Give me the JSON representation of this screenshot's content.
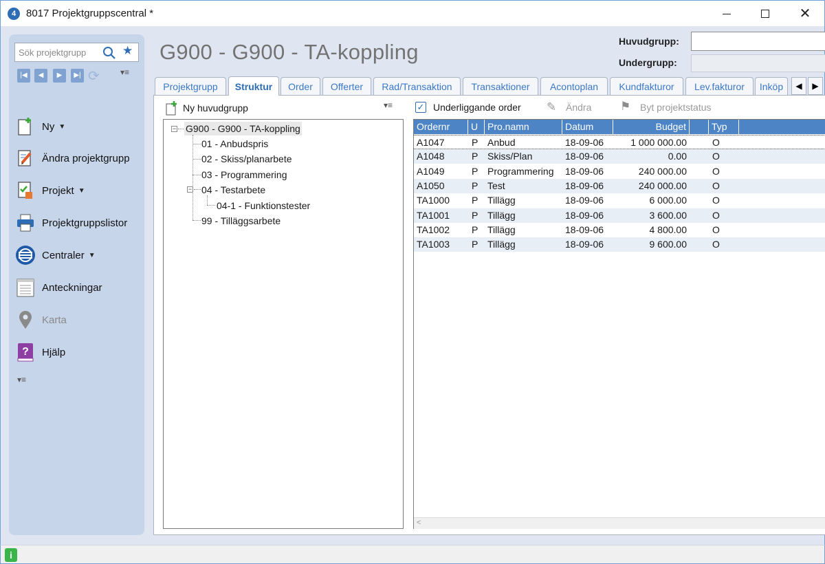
{
  "window": {
    "title": "8017 Projektgruppscentral *",
    "app_icon_text": "4"
  },
  "sidebar": {
    "search_placeholder": "Sök projektgrupp",
    "items": [
      {
        "label": "Ny",
        "icon": "new-document-icon",
        "dropdown": true
      },
      {
        "label": "Ändra projektgrupp",
        "icon": "edit-document-icon",
        "dropdown": false
      },
      {
        "label": "Projekt",
        "icon": "project-checklist-icon",
        "dropdown": true
      },
      {
        "label": "Projektgruppslistor",
        "icon": "printer-icon",
        "dropdown": false
      },
      {
        "label": "Centraler",
        "icon": "centraler-icon",
        "dropdown": true
      },
      {
        "label": "Anteckningar",
        "icon": "notepad-icon",
        "dropdown": false
      },
      {
        "label": "Karta",
        "icon": "map-pin-icon",
        "dropdown": false,
        "disabled": true
      },
      {
        "label": "Hjälp",
        "icon": "help-book-icon",
        "dropdown": false
      }
    ]
  },
  "header": {
    "page_title": "G900 - G900 - TA-koppling",
    "huvudgrupp_label": "Huvudgrupp:",
    "huvudgrupp_value": "",
    "undergrupp_label": "Undergrupp:",
    "undergrupp_value": ""
  },
  "tabs": [
    {
      "label": "Projektgrupp",
      "active": false
    },
    {
      "label": "Struktur",
      "active": true
    },
    {
      "label": "Order",
      "active": false
    },
    {
      "label": "Offerter",
      "active": false
    },
    {
      "label": "Rad/Transaktion",
      "active": false
    },
    {
      "label": "Transaktioner",
      "active": false
    },
    {
      "label": "Acontoplan",
      "active": false
    },
    {
      "label": "Kundfakturor",
      "active": false
    },
    {
      "label": "Lev.fakturor",
      "active": false
    },
    {
      "label": "Inköp",
      "active": false
    }
  ],
  "structure": {
    "new_button_label": "Ny huvudgrupp",
    "tree": {
      "root": "G900 - G900 - TA-koppling",
      "children": [
        "01 - Anbudspris",
        "02 - Skiss/planarbete",
        "03 - Programmering",
        "04 - Testarbete",
        "04-1 - Funktionstester",
        "99 - Tilläggsarbete"
      ]
    }
  },
  "orders": {
    "checkbox_label": "Underliggande order",
    "checkbox_checked": true,
    "edit_label": "Ändra",
    "status_label": "Byt projektstatus",
    "columns": [
      "Ordernr",
      "U",
      "Pro.namn",
      "Datum",
      "Budget",
      "Typ"
    ],
    "rows": [
      [
        "A1047",
        "P",
        "Anbud",
        "18-09-06",
        "1 000 000.00",
        "O"
      ],
      [
        "A1048",
        "P",
        "Skiss/Plan",
        "18-09-06",
        "0.00",
        "O"
      ],
      [
        "A1049",
        "P",
        "Programmering",
        "18-09-06",
        "240 000.00",
        "O"
      ],
      [
        "A1050",
        "P",
        "Test",
        "18-09-06",
        "240 000.00",
        "O"
      ],
      [
        "TA1000",
        "P",
        "Tillägg",
        "18-09-06",
        "6 000.00",
        "O"
      ],
      [
        "TA1001",
        "P",
        "Tillägg",
        "18-09-06",
        "3 600.00",
        "O"
      ],
      [
        "TA1002",
        "P",
        "Tillägg",
        "18-09-06",
        "4 800.00",
        "O"
      ],
      [
        "TA1003",
        "P",
        "Tillägg",
        "18-09-06",
        "9 600.00",
        "O"
      ]
    ]
  },
  "colors": {
    "accent": "#2d6db5",
    "grid_header": "#4d84c6",
    "sidebar_bg": "#c7d5ea"
  }
}
